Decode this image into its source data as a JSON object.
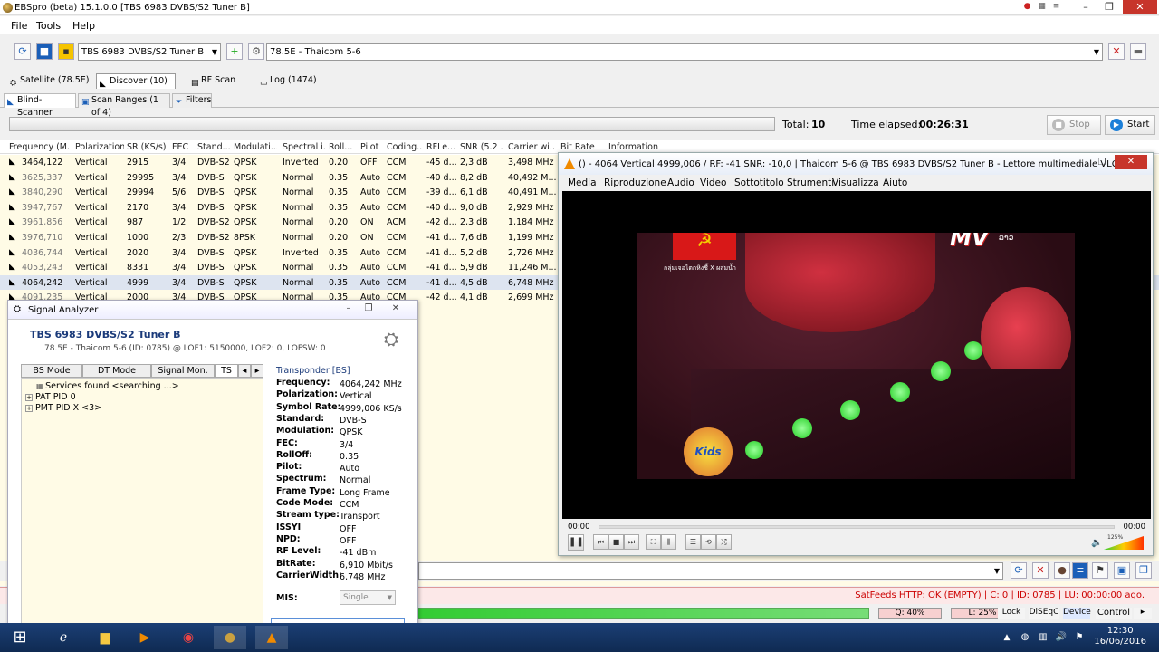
{
  "app": {
    "title": "EBSpro (beta) 15.1.0.0 [TBS 6983 DVBS/S2 Tuner B]",
    "menu": [
      "File",
      "Tools",
      "Help"
    ]
  },
  "toolbar": {
    "tuner": "TBS 6983 DVBS/S2 Tuner B",
    "satellite": "78.5E - Thaicom 5-6"
  },
  "tabs_top": [
    {
      "label": "Satellite (78.5E)"
    },
    {
      "label": "Discover (10)"
    },
    {
      "label": "RF Scan"
    },
    {
      "label": "Log (1474)"
    }
  ],
  "tabs_sub": [
    {
      "label": "Blind-Scanner"
    },
    {
      "label": "Scan Ranges (1 of 4)"
    },
    {
      "label": "Filters"
    }
  ],
  "scan": {
    "total_label": "Total:",
    "total": "10",
    "elapsed_label": "Time elapsed:",
    "elapsed": "00:26:31",
    "stop_label": "Stop",
    "start_label": "Start"
  },
  "grid": {
    "columns": [
      "Frequency (M...",
      "Polarization",
      "SR (KS/s)",
      "FEC",
      "Stand...",
      "Modulati...",
      "Spectral i...",
      "Roll...",
      "Pilot",
      "Coding...",
      "RFLe...",
      "SNR (5.2 ...",
      "Carrier wi...",
      "Bit Rate",
      "Information"
    ],
    "rows": [
      [
        "3464,122",
        "Vertical",
        "2915",
        "3/4",
        "DVB-S2",
        "QPSK",
        "Inverted",
        "0.20",
        "OFF",
        "CCM",
        "-45 d...",
        "2,3 dB",
        "3,498 MHz"
      ],
      [
        "3625,337",
        "Vertical",
        "29995",
        "3/4",
        "DVB-S",
        "QPSK",
        "Normal",
        "0.35",
        "Auto",
        "CCM",
        "-40 d...",
        "8,2 dB",
        "40,492 M..."
      ],
      [
        "3840,290",
        "Vertical",
        "29994",
        "5/6",
        "DVB-S",
        "QPSK",
        "Normal",
        "0.35",
        "Auto",
        "CCM",
        "-39 d...",
        "6,1 dB",
        "40,491 M..."
      ],
      [
        "3947,767",
        "Vertical",
        "2170",
        "3/4",
        "DVB-S",
        "QPSK",
        "Normal",
        "0.35",
        "Auto",
        "CCM",
        "-40 d...",
        "9,0 dB",
        "2,929 MHz"
      ],
      [
        "3961,856",
        "Vertical",
        "987",
        "1/2",
        "DVB-S2",
        "QPSK",
        "Normal",
        "0.20",
        "ON",
        "ACM",
        "-42 d...",
        "2,3 dB",
        "1,184 MHz"
      ],
      [
        "3976,710",
        "Vertical",
        "1000",
        "2/3",
        "DVB-S2",
        "8PSK",
        "Normal",
        "0.20",
        "ON",
        "CCM",
        "-41 d...",
        "7,6 dB",
        "1,199 MHz"
      ],
      [
        "4036,744",
        "Vertical",
        "2020",
        "3/4",
        "DVB-S",
        "QPSK",
        "Inverted",
        "0.35",
        "Auto",
        "CCM",
        "-41 d...",
        "5,2 dB",
        "2,726 MHz"
      ],
      [
        "4053,243",
        "Vertical",
        "8331",
        "3/4",
        "DVB-S",
        "QPSK",
        "Normal",
        "0.35",
        "Auto",
        "CCM",
        "-41 d...",
        "5,9 dB",
        "11,246 M..."
      ],
      [
        "4064,242",
        "Vertical",
        "4999",
        "3/4",
        "DVB-S",
        "QPSK",
        "Normal",
        "0.35",
        "Auto",
        "CCM",
        "-41 d...",
        "4,5 dB",
        "6,748 MHz"
      ],
      [
        "4091,235",
        "Vertical",
        "2000",
        "3/4",
        "DVB-S",
        "QPSK",
        "Normal",
        "0.35",
        "Auto",
        "CCM",
        "-42 d...",
        "4,1 dB",
        "2,699 MHz"
      ]
    ]
  },
  "signal_analyzer": {
    "title": "Signal Analyzer",
    "tuner": "TBS 6983 DVBS/S2 Tuner B",
    "sat_info": "78.5E - Thaicom 5-6 (ID: 0785) @ LOF1: 5150000, LOF2: 0, LOFSW: 0",
    "tabs": [
      "BS Mode",
      "DT Mode",
      "Signal Mon.",
      "TS Ar"
    ],
    "tree": [
      "Services found <searching ...>",
      "PAT PID 0",
      "PMT PID X <3>"
    ],
    "transponder_title": "Transponder [BS]",
    "fields": [
      {
        "label": "Frequency:",
        "value": "4064,242 MHz"
      },
      {
        "label": "Polarization:",
        "value": "Vertical"
      },
      {
        "label": "Symbol Rate:",
        "value": "4999,006 KS/s"
      },
      {
        "label": "Standard:",
        "value": "DVB-S"
      },
      {
        "label": "Modulation:",
        "value": "QPSK"
      },
      {
        "label": "FEC:",
        "value": "3/4"
      },
      {
        "label": "RollOff:",
        "value": "0.35"
      },
      {
        "label": "Pilot:",
        "value": "Auto"
      },
      {
        "label": "Spectrum:",
        "value": "Normal"
      },
      {
        "label": "Frame Type:",
        "value": "Long Frame"
      },
      {
        "label": "Code Mode:",
        "value": "CCM"
      },
      {
        "label": "Stream type:",
        "value": "Transport"
      },
      {
        "label": "ISSYI",
        "value": "OFF"
      },
      {
        "label": "NPD:",
        "value": "OFF"
      },
      {
        "label": "RF Level:",
        "value": "-41 dBm"
      },
      {
        "label": "BitRate:",
        "value": "6,910 Mbit/s"
      },
      {
        "label": "CarrierWidth:",
        "value": "6,748 MHz"
      }
    ],
    "mis_label": "MIS:",
    "mis_value": "Single"
  },
  "vlc": {
    "title": "() - 4064 Vertical 4999,006 / RF: -41 SNR: -10,0 | Thaicom 5-6 @ TBS 6983 DVBS/S2 Tuner B - Lettore multimediale VLC",
    "menu": [
      "Media",
      "Riproduzione",
      "Audio",
      "Video",
      "Sottotitolo",
      "Strumenti",
      "Visualizza",
      "Aiuto"
    ],
    "time_start": "00:00",
    "time_end": "00:00",
    "volume": "125%",
    "overlay_text": "กลุ่มเจอไตกหิ่งชี้ X ผสมน้ำ",
    "logo_text": "MV",
    "logo_sub": "ເມັນຂີ\nລາວ",
    "kids_text": "Kids"
  },
  "status": {
    "text": "SatFeeds HTTP: OK (EMPTY) | C: 0 | ID: 0785 | LU: 00:00:00 ago."
  },
  "levels": {
    "q": "Q: 40%",
    "l": "L: 25%",
    "lock": "Lock",
    "diseqc": "DiSEqC",
    "device": "Device",
    "control": "Control"
  },
  "taskbar": {
    "time": "12:30",
    "date": "16/06/2016"
  },
  "colors": {
    "accent": "#1b5fb8",
    "grid_bg": "#fffbe6",
    "status_red": "#cc0000",
    "green_level": "#33cc33"
  }
}
